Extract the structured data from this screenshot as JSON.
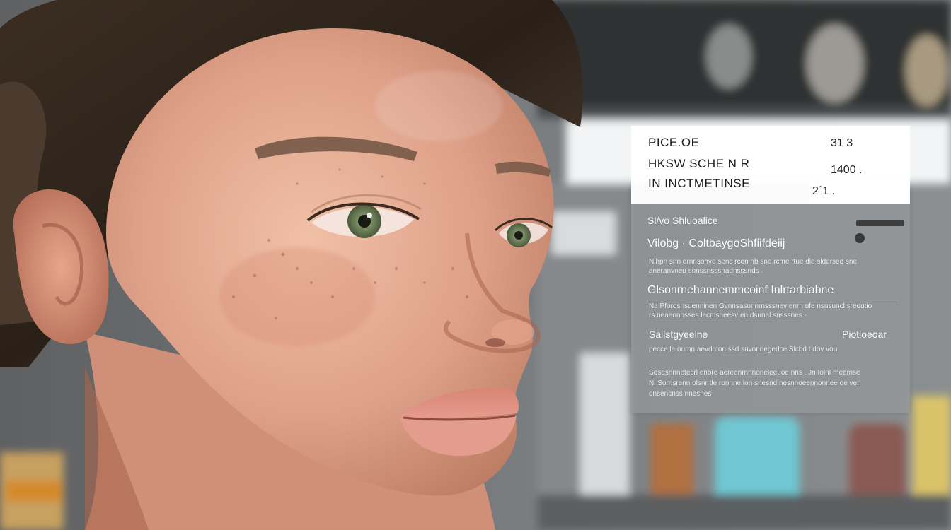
{
  "panel": {
    "header_rows": [
      {
        "label": "PICE.OE",
        "value": "31 3"
      },
      {
        "label": "HKSW SCHE N R",
        "value": "1400 ."
      },
      {
        "label": "IN INCTMETINSE",
        "value": "2´1 ."
      }
    ],
    "section1_title": "Sl/vo Shluoalice",
    "section2_title": "Vilobg · ColtbaygoShfiifdeiij",
    "section2_line": "Nlhpn snn ernnsonve senc rcon nb sne rcme rtue dle sldersed sne",
    "section2_line2": "aneranvneu sonssnsssnadnsssnds .",
    "section3_title": "Glsonrnehannemmcoinf Inlrtarbiabne",
    "section3_line": "Na Pforosnsuenninen Gvnnsasonnrnsssnev enrn ufe nsnsuncl sreoutio",
    "section3_line2": "rs neaeonnsses lecmsneesv en dsunal snsssnes -",
    "section4_left": "Sailstgyeelne",
    "section4_right": "Piotioeoar",
    "section4_line": "pecce le oumn aevdnton ssd suvonnegedce Slcbd t dov vou",
    "section5_line": "Sosesnnnetecrl enore aereenrnnnoneleeuoe nns . Jn IolnI meamse",
    "section5_line2": "Nl Sornsrenn olsnr tle ronnne lon snesnd nesnnoeennonnee oe ven",
    "section5_line3": "onsencnss nnesnes",
    "colors": {
      "panel": "#969a9e",
      "header": "#ffffff",
      "skin": "#e2a890"
    }
  }
}
